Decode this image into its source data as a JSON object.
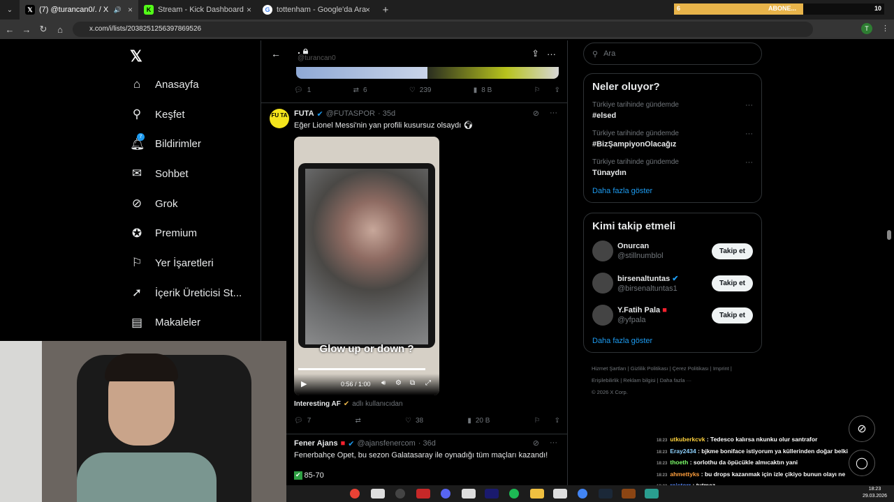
{
  "browser": {
    "tabs": [
      {
        "title": "(7) @turancan0/. / X"
      },
      {
        "title": "Stream - Kick Dashboard"
      },
      {
        "title": "tottenham - Google'da Ara"
      }
    ],
    "url": "x.com/i/lists/2038251256397869526",
    "extension": {
      "count": "6",
      "label": "ABONE...",
      "total": "10"
    }
  },
  "nav": {
    "items": [
      {
        "label": "Anasayfa",
        "icon": "home-icon"
      },
      {
        "label": "Keşfet",
        "icon": "search-icon"
      },
      {
        "label": "Bildirimler",
        "icon": "bell-icon",
        "badge": "7"
      },
      {
        "label": "Sohbet",
        "icon": "mail-icon"
      },
      {
        "label": "Grok",
        "icon": "grok-icon"
      },
      {
        "label": "Premium",
        "icon": "verified-icon"
      },
      {
        "label": "Yer İşaretleri",
        "icon": "bookmark-icon"
      },
      {
        "label": "İçerik Üreticisi St...",
        "icon": "rocket-icon"
      },
      {
        "label": "Makaleler",
        "icon": "article-icon"
      }
    ]
  },
  "header": {
    "handle": "@turancan0",
    "dot": "."
  },
  "tweet0": {
    "replies": "1",
    "retweets": "6",
    "likes": "239",
    "views": "8 B"
  },
  "tweet1": {
    "name": "FUTA",
    "handle": "@FUTASPOR",
    "time": "· 35d",
    "avatar_text": "FU TA",
    "text": "Eğer Lionel Messi'nin yan profili kusursuz olsaydı",
    "video_caption": "Glow up or down ?",
    "video_time": "0:56 / 1:00",
    "source_name": "Interesting AF",
    "source_suffix": "adlı kullanıcıdan",
    "replies": "7",
    "likes": "38",
    "views": "20 B"
  },
  "tweet2": {
    "name": "Fener Ajans",
    "handle": "@ajansfenercom",
    "time": "· 36d",
    "text": "Fenerbahçe Opet, bu sezon Galatasaray ile oynadığı tüm maçları kazandı!",
    "score": "85-70"
  },
  "search": {
    "placeholder": "Ara"
  },
  "trends": {
    "title": "Neler oluyor?",
    "items": [
      {
        "cat": "Türkiye tarihinde gündemde",
        "name": "#elsed"
      },
      {
        "cat": "Türkiye tarihinde gündemde",
        "name": "#BizŞampiyonOlacağız"
      },
      {
        "cat": "Türkiye tarihinde gündemde",
        "name": "Tünaydın"
      }
    ],
    "more": "Daha fazla göster"
  },
  "follow": {
    "title": "Kimi takip etmeli",
    "items": [
      {
        "name": "Onurcan",
        "handle": "@stillnumblol"
      },
      {
        "name": "birsenaltuntas",
        "handle": "@birsenaltuntas1"
      },
      {
        "name": "Y.Fatih Pala",
        "handle": "@yfpala"
      }
    ],
    "button": "Takip et",
    "more": "Daha fazla göster"
  },
  "footer": {
    "links": [
      "Hizmet Şartları",
      "Gizlilik Politikası",
      "Çerez Politikası",
      "Imprint",
      "Erişilebilirlik",
      "Reklam bilgisi",
      "Daha fazla ···"
    ],
    "copyright": "© 2026 X Corp."
  },
  "chat": [
    {
      "time": "18:23",
      "user": "utkuberkcvk",
      "color": "#ffd23d",
      "msg": "Tedesco kalırsa nkunku olur santrafor"
    },
    {
      "time": "18:23",
      "user": "Eray2434",
      "color": "#8fd3ff",
      "msg": "bjkme boniface istiyorum ya küllerinden doğar belki"
    },
    {
      "time": "18:23",
      "user": "thoeth",
      "color": "#7dff6a",
      "msg": "sorlothu da öpücükle almıcaktın yani"
    },
    {
      "time": "18:23",
      "user": "ahmettyks",
      "color": "#ff9f3d",
      "msg": "bu drops kazanmak için izle çikiyo bunun olayı ne"
    },
    {
      "time": "18:23",
      "user": "raistorr",
      "color": "#5b8cff",
      "msg": "tutmaz"
    }
  ],
  "taskbar": {
    "time": "18:23",
    "date": "29.03.2026"
  }
}
